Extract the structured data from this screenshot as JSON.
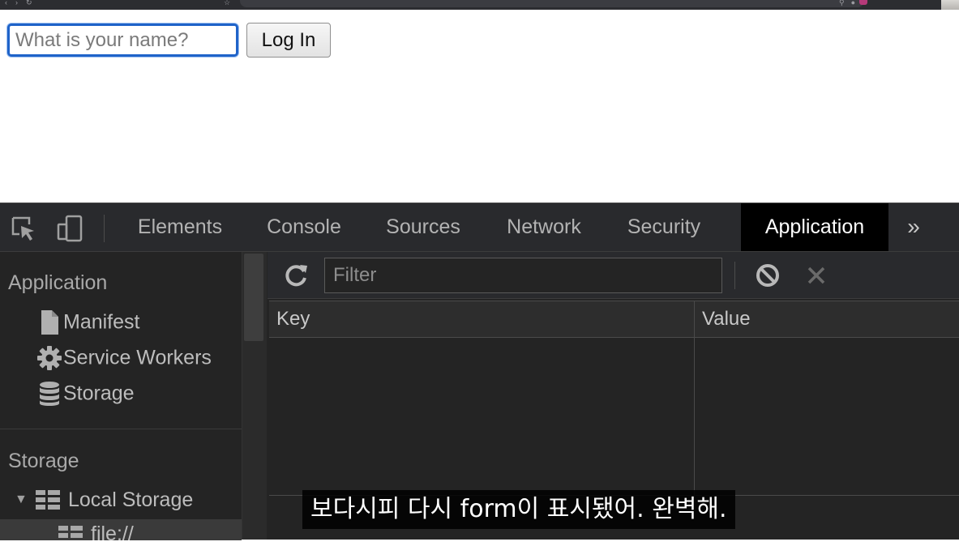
{
  "page": {
    "name_input": {
      "placeholder": "What is your name?",
      "value": ""
    },
    "login_button": "Log In"
  },
  "devtools": {
    "tabs": [
      {
        "label": "Elements"
      },
      {
        "label": "Console"
      },
      {
        "label": "Sources"
      },
      {
        "label": "Network"
      },
      {
        "label": "Security"
      },
      {
        "label": "Application",
        "active": true
      }
    ],
    "more_tabs": "»",
    "sidebar": {
      "application_heading": "Application",
      "application_items": [
        {
          "label": "Manifest",
          "icon": "file-icon"
        },
        {
          "label": "Service Workers",
          "icon": "gear-icon"
        },
        {
          "label": "Storage",
          "icon": "database-icon"
        }
      ],
      "storage_heading": "Storage",
      "storage_items": [
        {
          "label": "Local Storage",
          "icon": "grid-icon",
          "expanded": true
        },
        {
          "label": "file://",
          "icon": "grid-icon"
        }
      ]
    },
    "main": {
      "filter_placeholder": "Filter",
      "columns": [
        "Key",
        "Value"
      ]
    }
  },
  "subtitle": "보다시피 다시 form이 표시됐어. 완벽해."
}
